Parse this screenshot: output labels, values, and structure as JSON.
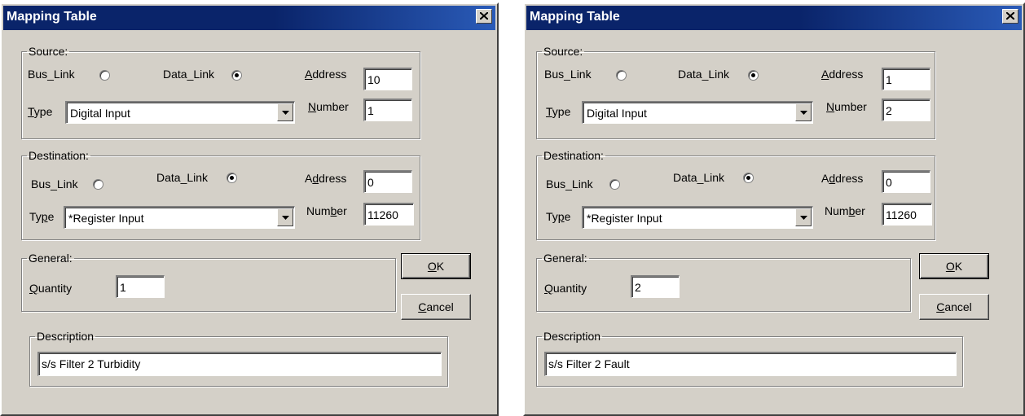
{
  "dialogs": [
    {
      "title": "Mapping Table",
      "source": {
        "legend": "Source:",
        "bus_link_label_pre": "Bus_Link",
        "data_link_label": "Data_Link",
        "address_label": "ddress",
        "address_key": "A",
        "address_value": "10",
        "type_key": "T",
        "type_label": "ype",
        "type_value": "Digital Input",
        "number_key": "N",
        "number_label": "umber",
        "number_value": "1",
        "selected": "Data_Link"
      },
      "destination": {
        "legend": "Destination:",
        "bus_link_label": "Bus_Link",
        "data_link_label": "Data_Link",
        "address_pre": "A",
        "address_key": "d",
        "address_post": "dress",
        "address_value": "0",
        "type_pre": "Ty",
        "type_key": "p",
        "type_post": "e",
        "type_value": "*Register Input",
        "number_pre": "Num",
        "number_key": "b",
        "number_post": "er",
        "number_value": "11260",
        "selected": "Data_Link"
      },
      "general": {
        "legend": "General:",
        "quantity_key": "Q",
        "quantity_label": "uantity",
        "quantity_value": "1"
      },
      "buttons": {
        "ok_key": "O",
        "ok_rest": "K",
        "cancel_key": "C",
        "cancel_rest": "ancel"
      },
      "description": {
        "legend": "Description",
        "value": "s/s Filter 2 Turbidity"
      }
    },
    {
      "title": "Mapping Table",
      "source": {
        "legend": "Source:",
        "bus_link_label_pre": "Bus_Link",
        "data_link_label": "Data_Link",
        "address_label": "ddress",
        "address_key": "A",
        "address_value": "1",
        "type_key": "T",
        "type_label": "ype",
        "type_value": "Digital Input",
        "number_key": "N",
        "number_label": "umber",
        "number_value": "2",
        "selected": "Data_Link"
      },
      "destination": {
        "legend": "Destination:",
        "bus_link_label": "Bus_Link",
        "data_link_label": "Data_Link",
        "address_pre": "A",
        "address_key": "d",
        "address_post": "dress",
        "address_value": "0",
        "type_pre": "Ty",
        "type_key": "p",
        "type_post": "e",
        "type_value": "*Register Input",
        "number_pre": "Num",
        "number_key": "b",
        "number_post": "er",
        "number_value": "11260",
        "selected": "Data_Link"
      },
      "general": {
        "legend": "General:",
        "quantity_key": "Q",
        "quantity_label": "uantity",
        "quantity_value": "2"
      },
      "buttons": {
        "ok_key": "O",
        "ok_rest": "K",
        "cancel_key": "C",
        "cancel_rest": "ancel"
      },
      "description": {
        "legend": "Description",
        "value": "s/s Filter 2 Fault"
      }
    }
  ],
  "icons": {
    "close": "close-icon",
    "dropdown": "chevron-down-icon"
  },
  "colors": {
    "titlebar": "#0a246a",
    "face": "#d4d0c8"
  }
}
